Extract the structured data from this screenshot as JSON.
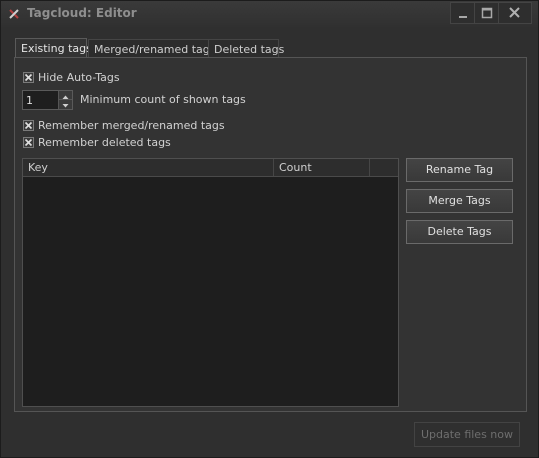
{
  "window": {
    "title": "Tagcloud: Editor",
    "controls": [
      "minimize-icon",
      "maximize-icon",
      "close-icon"
    ]
  },
  "tabs": [
    {
      "label": "Existing tags",
      "active": true
    },
    {
      "label": "Merged/renamed tags",
      "active": false
    },
    {
      "label": "Deleted tags",
      "active": false
    }
  ],
  "options": {
    "hide_auto_tags": {
      "label": "Hide Auto-Tags",
      "checked": true
    },
    "min_count": {
      "label": "Minimum count of shown tags",
      "value": "1"
    },
    "remember_merged": {
      "label": "Remember merged/renamed tags",
      "checked": true
    },
    "remember_deleted": {
      "label": "Remember deleted tags",
      "checked": true
    }
  },
  "table": {
    "columns": [
      "Key",
      "Count"
    ],
    "rows": []
  },
  "actions": {
    "rename": "Rename Tag",
    "merge": "Merge Tags",
    "delete": "Delete Tags"
  },
  "footer": {
    "update": "Update files now",
    "update_enabled": false
  }
}
